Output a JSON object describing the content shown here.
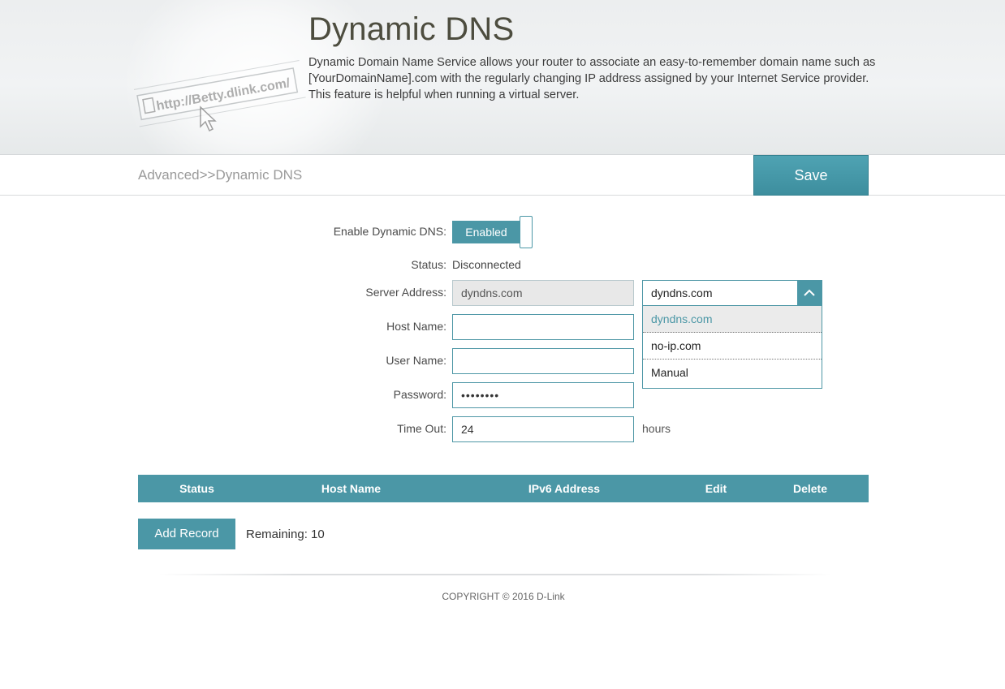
{
  "header": {
    "title": "Dynamic DNS",
    "description": "Dynamic Domain Name Service allows your router to associate an easy-to-remember domain name such as [YourDomainName].com with the regularly changing IP address assigned by your Internet Service provider. This feature is helpful when running a virtual server.",
    "illustration_text": "http://Betty.dlink.com/"
  },
  "breadcrumb": "Advanced>>Dynamic DNS",
  "toolbar": {
    "save_label": "Save"
  },
  "form": {
    "enable": {
      "label": "Enable Dynamic DNS:",
      "value": "Enabled"
    },
    "status": {
      "label": "Status:",
      "value": "Disconnected"
    },
    "server_address": {
      "label": "Server Address:",
      "value": "dyndns.com",
      "select_value": "dyndns.com",
      "options": [
        "dyndns.com",
        "no-ip.com",
        "Manual"
      ]
    },
    "host_name": {
      "label": "Host Name:",
      "value": ""
    },
    "user_name": {
      "label": "User Name:",
      "value": ""
    },
    "password": {
      "label": "Password:",
      "value": "••••••••"
    },
    "time_out": {
      "label": "Time Out:",
      "value": "24",
      "unit": "hours"
    }
  },
  "table": {
    "columns": [
      "Status",
      "Host Name",
      "IPv6 Address",
      "Edit",
      "Delete"
    ]
  },
  "records": {
    "add_label": "Add Record",
    "remaining": "Remaining: 10"
  },
  "footer": {
    "copyright": "COPYRIGHT © 2016 D-Link"
  },
  "colors": {
    "accent": "#4b97a6",
    "accent_dark": "#3d8e9e"
  },
  "icons": {
    "select_arrow": "chevron-up-icon",
    "illustration": "browser-url-illustration"
  }
}
